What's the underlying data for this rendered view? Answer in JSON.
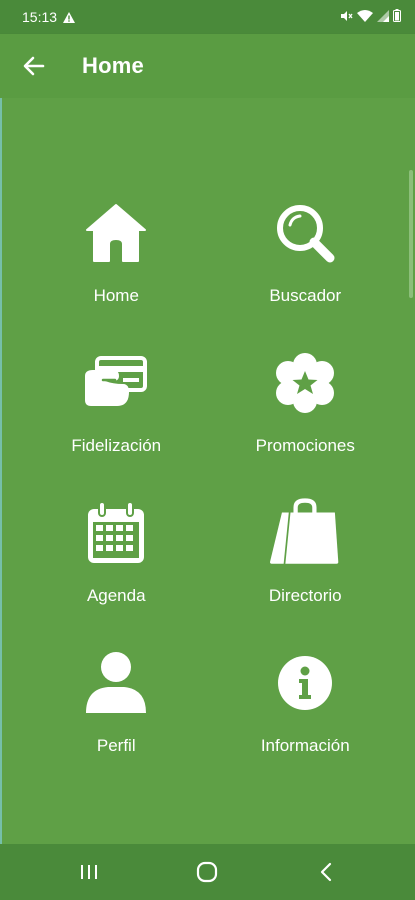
{
  "status_bar": {
    "time": "15:13"
  },
  "app_bar": {
    "title": "Home"
  },
  "menu": [
    {
      "id": "home",
      "label": "Home",
      "icon": "house-icon"
    },
    {
      "id": "buscador",
      "label": "Buscador",
      "icon": "search-icon"
    },
    {
      "id": "fidelizacion",
      "label": "Fidelización",
      "icon": "card-in-hand-icon"
    },
    {
      "id": "promociones",
      "label": "Promociones",
      "icon": "star-badge-icon"
    },
    {
      "id": "agenda",
      "label": "Agenda",
      "icon": "calendar-icon"
    },
    {
      "id": "directorio",
      "label": "Directorio",
      "icon": "shopping-bag-icon"
    },
    {
      "id": "perfil",
      "label": "Perfil",
      "icon": "user-icon"
    },
    {
      "id": "informacion",
      "label": "Información",
      "icon": "info-icon"
    }
  ],
  "colors": {
    "background": "#5fa046",
    "app_bar": "#5a9c42",
    "system_bars": "#4a8a3a",
    "foreground": "#ffffff"
  }
}
